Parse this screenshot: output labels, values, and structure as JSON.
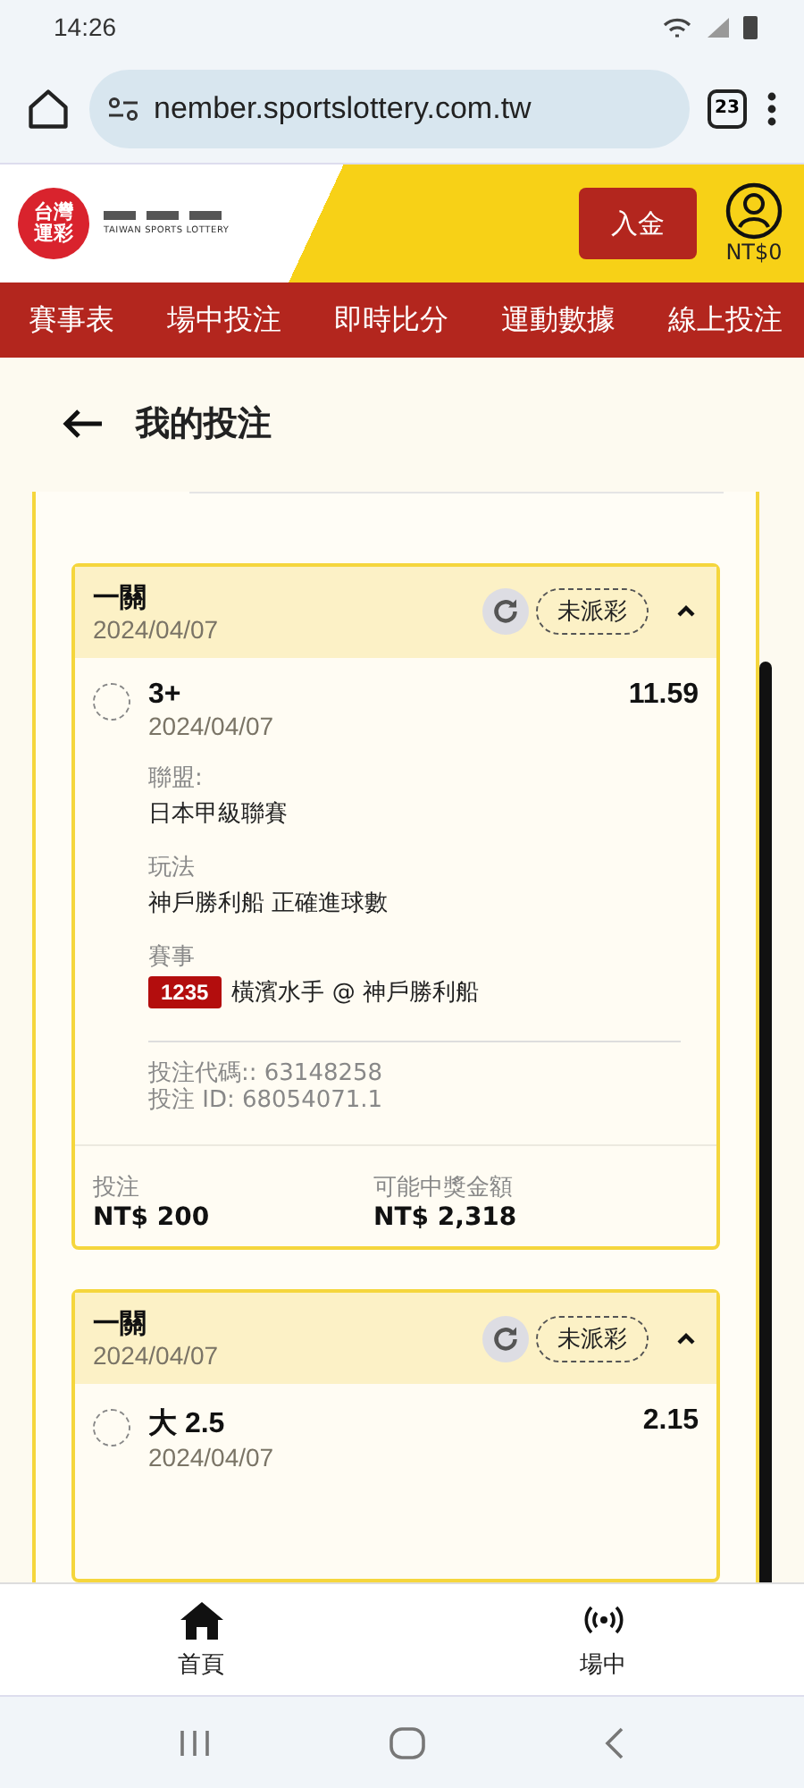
{
  "status_bar": {
    "time": "14:26"
  },
  "browser": {
    "url": "nember.sportslottery.com.tw",
    "tab_count": "23"
  },
  "site_header": {
    "logo_text": "台灣運彩",
    "logo_subtitle": "TAIWAN SPORTS LOTTERY",
    "deposit_button": "入金",
    "balance": "NT$0"
  },
  "nav": [
    {
      "label": "賽事表"
    },
    {
      "label": "場中投注"
    },
    {
      "label": "即時比分"
    },
    {
      "label": "運動數據"
    },
    {
      "label": "線上投注"
    }
  ],
  "page_title": "我的投注",
  "bets": [
    {
      "type": "一關",
      "date": "2024/04/07",
      "status": "未派彩",
      "expanded": true,
      "pick": "3+",
      "pick_date": "2024/04/07",
      "odds": "11.59",
      "details": [
        {
          "label": "聯盟:",
          "value": "日本甲級聯賽"
        },
        {
          "label": "玩法",
          "value": "神戶勝利船 正確進球數"
        },
        {
          "label": "賽事",
          "code": "1235",
          "value": "橫濱水手 @ 神戶勝利船"
        }
      ],
      "ids": [
        "投注代碼:: 63148258",
        "投注 ID: 68054071.1"
      ],
      "stake_label": "投注",
      "stake": "NT$ 200",
      "payout_label": "可能中獎金額",
      "payout": "NT$ 2,318"
    },
    {
      "type": "一關",
      "date": "2024/04/07",
      "status": "未派彩",
      "expanded": true,
      "pick": "大 2.5",
      "pick_date": "2024/04/07",
      "odds": "2.15"
    }
  ],
  "bottom_nav": [
    {
      "label": "首頁",
      "kind": "home"
    },
    {
      "label": "場中",
      "kind": "live"
    }
  ]
}
